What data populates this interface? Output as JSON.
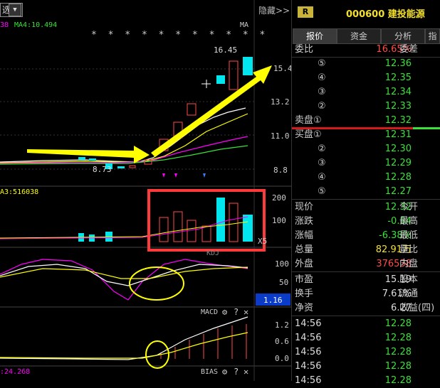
{
  "toolbar": {
    "select_label": "选",
    "hide_label": "隐藏>>"
  },
  "ma_header": "MA4:10.494",
  "ma_tag": "MA",
  "ma_marker": "38",
  "price_axis": [
    "15.4",
    "13.2",
    "11.0",
    "8.8"
  ],
  "high_label": "16.45",
  "low_label": "8.73",
  "vol_header": "A3:516038",
  "vol_axis": [
    "200",
    "100",
    "X5"
  ],
  "kdj_header": "KDJ",
  "kdj_axis": [
    "100",
    "50"
  ],
  "kdj_value_box": "1.16",
  "macd_header": "MACD",
  "macd_axis": [
    "1.2",
    "0.6",
    "0.0"
  ],
  "bias_header": "BIAS",
  "bias_value": ":24.268",
  "stars": "* * * * * * * * * * *",
  "icons": {
    "gear": "gear-icon",
    "help": "help-icon",
    "close": "close-icon"
  },
  "colors": {
    "up": "#ff4a4a",
    "down": "#00e5ee",
    "yellow": "#ffff00",
    "magenta": "#ff00ff",
    "green": "#3ae13a"
  },
  "stock": {
    "badge": "R",
    "code_name": "000600 建投能源"
  },
  "tabs": [
    "报价",
    "资金",
    "分析",
    "指"
  ],
  "weibi": {
    "label": "委比",
    "value": "16.65%",
    "tail": "委差"
  },
  "sells": [
    {
      "label": "⑤",
      "price": "12.36"
    },
    {
      "label": "④",
      "price": "12.35"
    },
    {
      "label": "③",
      "price": "12.34"
    },
    {
      "label": "②",
      "price": "12.33"
    },
    {
      "label": "卖盘①",
      "price": "12.32"
    }
  ],
  "buys": [
    {
      "label": "买盘①",
      "price": "12.31"
    },
    {
      "label": "②",
      "price": "12.30"
    },
    {
      "label": "③",
      "price": "12.29"
    },
    {
      "label": "④",
      "price": "12.28"
    },
    {
      "label": "⑤",
      "price": "12.27"
    }
  ],
  "quote": [
    {
      "label": "现价",
      "value": "12.32",
      "tail": "今开",
      "cls": "grn"
    },
    {
      "label": "涨跌",
      "value": "-0.84",
      "tail": "最高",
      "cls": "grn"
    },
    {
      "label": "涨幅",
      "value": "-6.38%",
      "tail": "最低",
      "cls": "grn"
    },
    {
      "label": "总量",
      "value": "82.91万",
      "tail": "量比",
      "cls": "yel"
    },
    {
      "label": "外盘",
      "value": "376538",
      "tail": "内盘",
      "cls": "red"
    }
  ],
  "fund": [
    {
      "label": "市盈",
      "value": "15.19",
      "tail": "股本"
    },
    {
      "label": "换手",
      "value": "7.61%",
      "tail": "流通"
    },
    {
      "label": "净资",
      "value": "6.27",
      "tail": "收益(四)"
    }
  ],
  "ticks": [
    {
      "time": "14:56",
      "price": "12.28"
    },
    {
      "time": "14:56",
      "price": "12.28"
    },
    {
      "time": "14:56",
      "price": "12.28"
    },
    {
      "time": "14:56",
      "price": "12.28"
    },
    {
      "time": "14:56",
      "price": "12.28"
    }
  ]
}
